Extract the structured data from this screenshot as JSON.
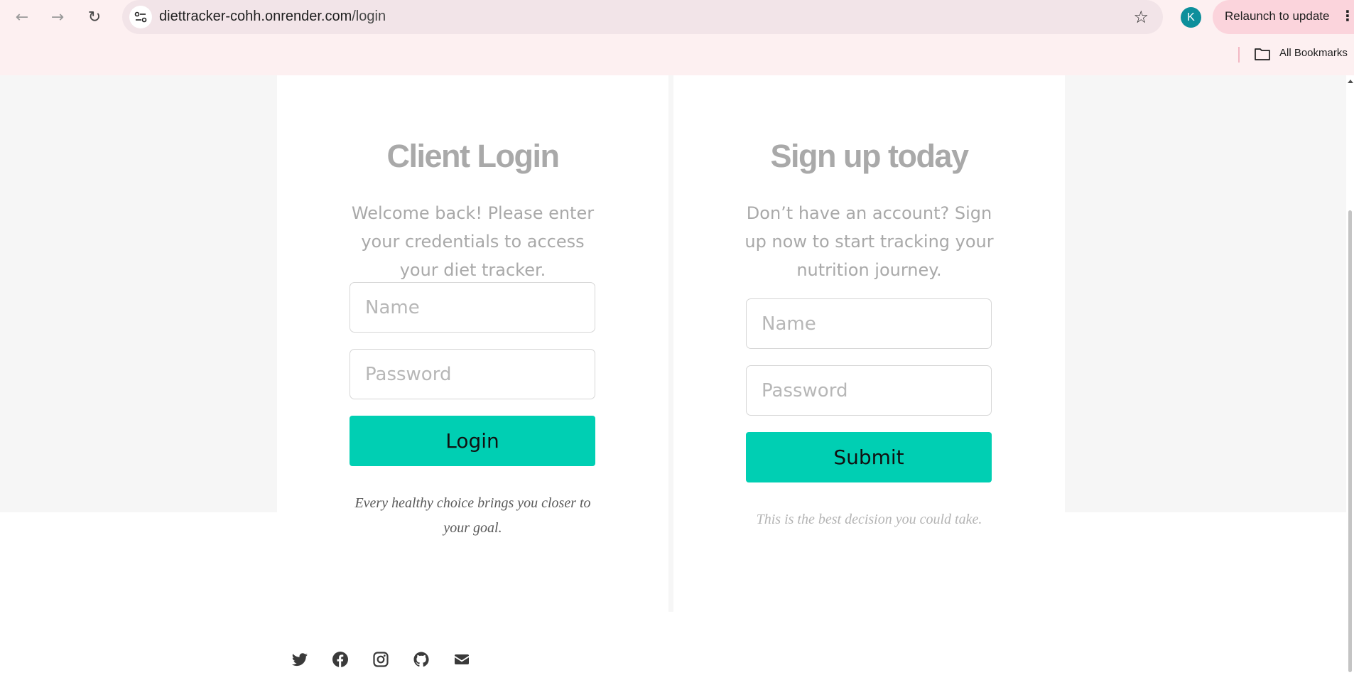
{
  "browser": {
    "url_host": "diettracker-cohh.onrender.com",
    "url_path": "/login",
    "avatar_letter": "K",
    "relaunch_label": "Relaunch to update",
    "bookmarks_label": "All Bookmarks"
  },
  "login": {
    "title": "Client Login",
    "description": "Welcome back! Please enter your credentials to access your diet tracker.",
    "name_placeholder": "Name",
    "password_placeholder": "Password",
    "button_label": "Login",
    "quote": "Every healthy choice brings you closer to your goal."
  },
  "signup": {
    "title": "Sign up today",
    "description": "Don’t have an account? Sign up now to start tracking your nutrition journey.",
    "name_placeholder": "Name",
    "password_placeholder": "Password",
    "button_label": "Submit",
    "quote": "This is the best decision you could take."
  },
  "footer": {
    "social_icons": [
      "twitter-icon",
      "facebook-icon",
      "instagram-icon",
      "github-icon",
      "email-icon"
    ]
  },
  "colors": {
    "accent": "#00cfb3",
    "heading_gray": "#a9a9a9",
    "chrome_bg": "#fdf0f1",
    "relaunch_bg": "#fbd4dc",
    "avatar_bg": "#0d8f9b"
  }
}
